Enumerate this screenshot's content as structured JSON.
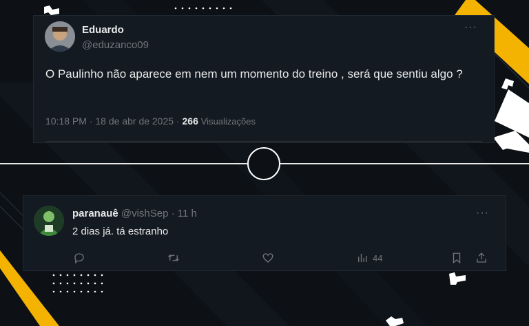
{
  "colors": {
    "background": "#0d1116",
    "card": "#141a22",
    "accent_yellow": "#f5b301",
    "text_primary": "#e7e9ea",
    "text_muted": "#71767b"
  },
  "tweet": {
    "author_name": "Eduardo",
    "author_handle": "@eduzanco09",
    "more_icon": "more-horizontal-icon",
    "text": "O Paulinho não aparece em nem um momento do treino , será que sentiu algo ?",
    "time": "10:18 PM",
    "date": "18 de abr de 2025",
    "views_count": "266",
    "views_label": "Visualizações"
  },
  "reply": {
    "author_name": "paranauê",
    "author_handle": "@vishSep",
    "separator": "·",
    "age": "11 h",
    "text": "2 dias já. tá estranho",
    "views_count": "44",
    "actions": [
      "reply-icon",
      "retweet-icon",
      "like-icon",
      "views-icon",
      "bookmark-icon",
      "share-icon"
    ]
  }
}
